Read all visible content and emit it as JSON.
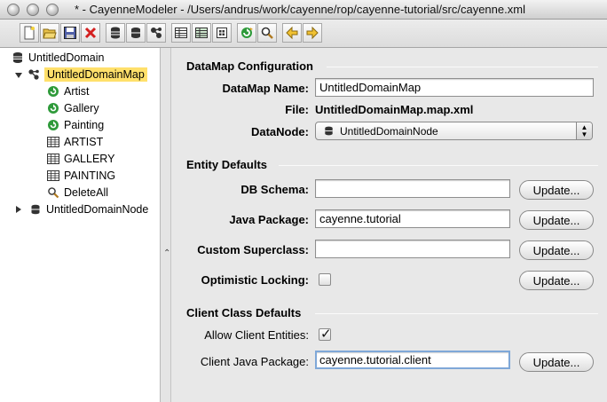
{
  "window": {
    "title": "* - CayenneModeler - /Users/andrus/work/cayenne/rop/cayenne-tutorial/src/cayenne.xml"
  },
  "toolbar": {
    "buttons": [
      "new-project-icon",
      "open-project-icon",
      "save-icon",
      "remove-icon",
      "create-domain-icon",
      "create-datanode-icon",
      "create-datamap-icon",
      "create-objentity-icon",
      "create-dbentity-icon",
      "create-procedure-icon",
      "synchronize-icon",
      "create-query-icon",
      "navigate-back-icon",
      "navigate-forward-icon"
    ]
  },
  "tree": {
    "domain": "UntitledDomain",
    "datamap": "UntitledDomainMap",
    "children": [
      {
        "label": "Artist",
        "icon": "objentity-icon"
      },
      {
        "label": "Gallery",
        "icon": "objentity-icon"
      },
      {
        "label": "Painting",
        "icon": "objentity-icon"
      },
      {
        "label": "ARTIST",
        "icon": "dbentity-icon"
      },
      {
        "label": "GALLERY",
        "icon": "dbentity-icon"
      },
      {
        "label": "PAINTING",
        "icon": "dbentity-icon"
      },
      {
        "label": "DeleteAll",
        "icon": "query-icon"
      }
    ],
    "datanode": "UntitledDomainNode"
  },
  "datamap_config": {
    "heading": "DataMap Configuration",
    "name_label": "DataMap Name:",
    "name_value": "UntitledDomainMap",
    "file_label": "File:",
    "file_value": "UntitledDomainMap.map.xml",
    "datanode_label": "DataNode:",
    "datanode_value": "UntitledDomainNode"
  },
  "entity_defaults": {
    "heading": "Entity Defaults",
    "db_schema_label": "DB Schema:",
    "db_schema_value": "",
    "java_package_label": "Java Package:",
    "java_package_value": "cayenne.tutorial",
    "superclass_label": "Custom Superclass:",
    "superclass_value": "",
    "locking_label": "Optimistic Locking:",
    "locking_checked": false
  },
  "client_defaults": {
    "heading": "Client Class Defaults",
    "allow_label": "Allow Client Entities:",
    "allow_checked": true,
    "client_package_label": "Client Java Package:",
    "client_package_value": "cayenne.tutorial.client"
  },
  "buttons": {
    "update_label": "Update..."
  },
  "colors": {
    "selection": "#ffe06b",
    "objentity_green": "#2e9a3a",
    "remove_red": "#d42020",
    "focus_ring": "#7fa8d8"
  }
}
